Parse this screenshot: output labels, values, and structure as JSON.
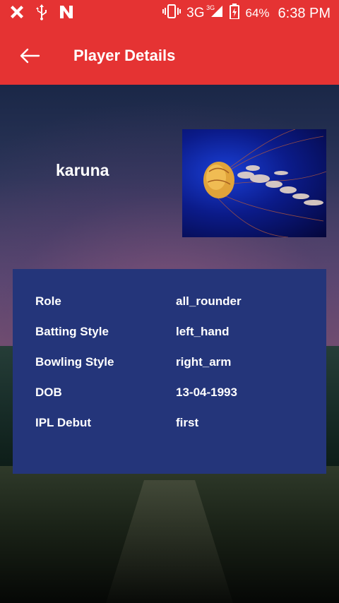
{
  "status_bar": {
    "network": "3G",
    "network_sup": "3G",
    "battery": "64%",
    "time": "6:38 PM"
  },
  "app_bar": {
    "title": "Player Details"
  },
  "player": {
    "name": "karuna"
  },
  "details": [
    {
      "label": "Role",
      "value": "all_rounder"
    },
    {
      "label": "Batting Style",
      "value": "left_hand"
    },
    {
      "label": "Bowling Style",
      "value": "right_arm"
    },
    {
      "label": "DOB",
      "value": "13-04-1993"
    },
    {
      "label": "IPL Debut",
      "value": "first"
    }
  ],
  "colors": {
    "primary": "#e53333",
    "card": "#24357a"
  }
}
